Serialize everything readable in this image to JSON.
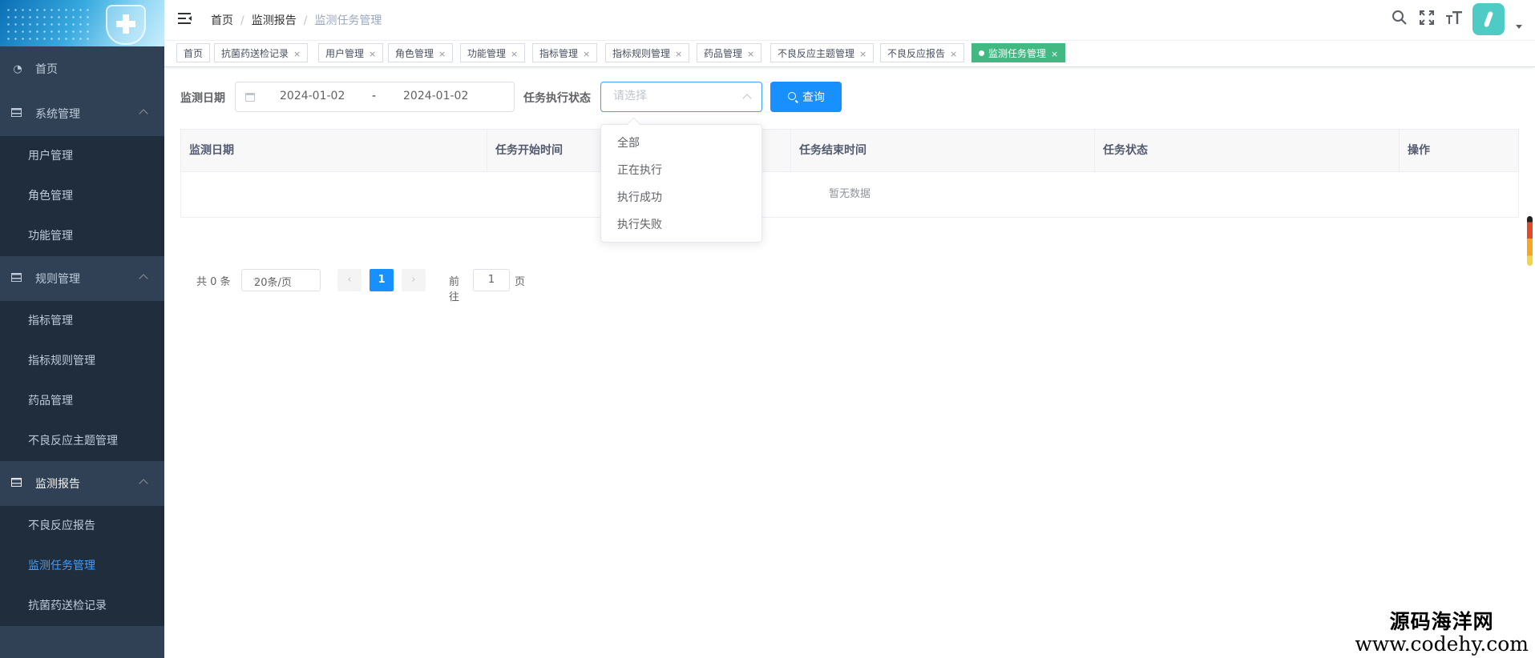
{
  "sidebar": {
    "home": "首页",
    "groups": [
      {
        "label": "系统管理",
        "items": [
          "用户管理",
          "角色管理",
          "功能管理"
        ]
      },
      {
        "label": "规则管理",
        "items": [
          "指标管理",
          "指标规则管理",
          "药品管理",
          "不良反应主题管理"
        ]
      },
      {
        "label": "监测报告",
        "items": [
          "不良反应报告",
          "监测任务管理",
          "抗菌药送检记录"
        ]
      }
    ],
    "active_item": "监测任务管理"
  },
  "header": {
    "breadcrumb": [
      "首页",
      "监测报告",
      "监测任务管理"
    ],
    "icons": [
      "search-icon",
      "fullscreen-icon",
      "font-size-icon",
      "avatar",
      "caret-down-icon"
    ]
  },
  "tags": [
    {
      "label": "首页",
      "closable": false
    },
    {
      "label": "抗菌药送检记录",
      "closable": true
    },
    {
      "label": "用户管理",
      "closable": true
    },
    {
      "label": "角色管理",
      "closable": true
    },
    {
      "label": "功能管理",
      "closable": true
    },
    {
      "label": "指标管理",
      "closable": true
    },
    {
      "label": "指标规则管理",
      "closable": true
    },
    {
      "label": "药品管理",
      "closable": true
    },
    {
      "label": "不良反应主题管理",
      "closable": true
    },
    {
      "label": "不良反应报告",
      "closable": true
    },
    {
      "label": "监测任务管理",
      "closable": true,
      "active": true
    }
  ],
  "search": {
    "date_label": "监测日期",
    "date_start": "2024-01-02",
    "date_separator": "-",
    "date_end": "2024-01-02",
    "status_label": "任务执行状态",
    "status_placeholder": "请选择",
    "status_options": [
      "全部",
      "正在执行",
      "执行成功",
      "执行失败"
    ],
    "query_button": "查询"
  },
  "table": {
    "columns": [
      "监测日期",
      "任务开始时间",
      "任务结束时间",
      "任务状态",
      "操作"
    ],
    "empty_text": "暂无数据"
  },
  "pagination": {
    "total_text": "共 0 条",
    "page_size": "20条/页",
    "prev": "‹",
    "current_page": "1",
    "next": "›",
    "goto_label": "前往",
    "goto_value": "1",
    "page_unit": "页"
  },
  "watermark": {
    "line1": "源码海洋网",
    "line2": "www.codehy.com"
  },
  "colors": {
    "sidebar_bg": "#304156",
    "submenu_bg": "#1f2d3d",
    "active_text": "#409eff",
    "primary_button": "#1890ff",
    "active_tag": "#42b983"
  }
}
